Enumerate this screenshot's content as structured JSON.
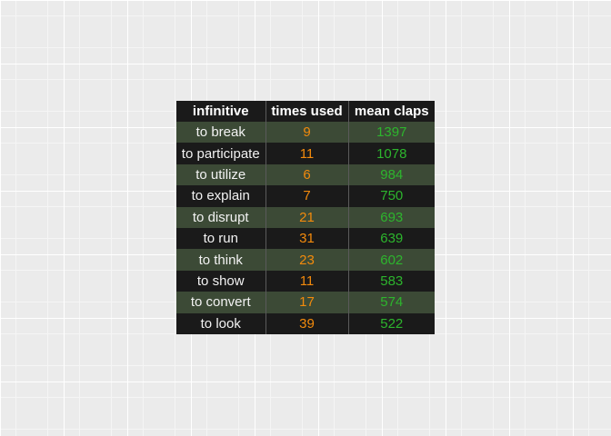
{
  "chart_data": {
    "type": "table",
    "columns": [
      "infinitive",
      "times used",
      "mean claps"
    ],
    "rows": [
      [
        "to break",
        "9",
        "1397"
      ],
      [
        "to participate",
        "11",
        "1078"
      ],
      [
        "to utilize",
        "6",
        "984"
      ],
      [
        "to explain",
        "7",
        "750"
      ],
      [
        "to disrupt",
        "21",
        "693"
      ],
      [
        "to run",
        "31",
        "639"
      ],
      [
        "to think",
        "23",
        "602"
      ],
      [
        "to show",
        "11",
        "583"
      ],
      [
        "to convert",
        "17",
        "574"
      ],
      [
        "to look",
        "39",
        "522"
      ]
    ],
    "colors": {
      "header_bg": "#1a1a1a",
      "row_odd_bg": "#3c4a36",
      "row_even_bg": "#1a1a1a",
      "infinitive_text": "#f2f2f2",
      "times_used_text": "#f28a0c",
      "mean_claps_text": "#2db52d",
      "panel_bg": "#ebebeb"
    },
    "grid": true
  }
}
